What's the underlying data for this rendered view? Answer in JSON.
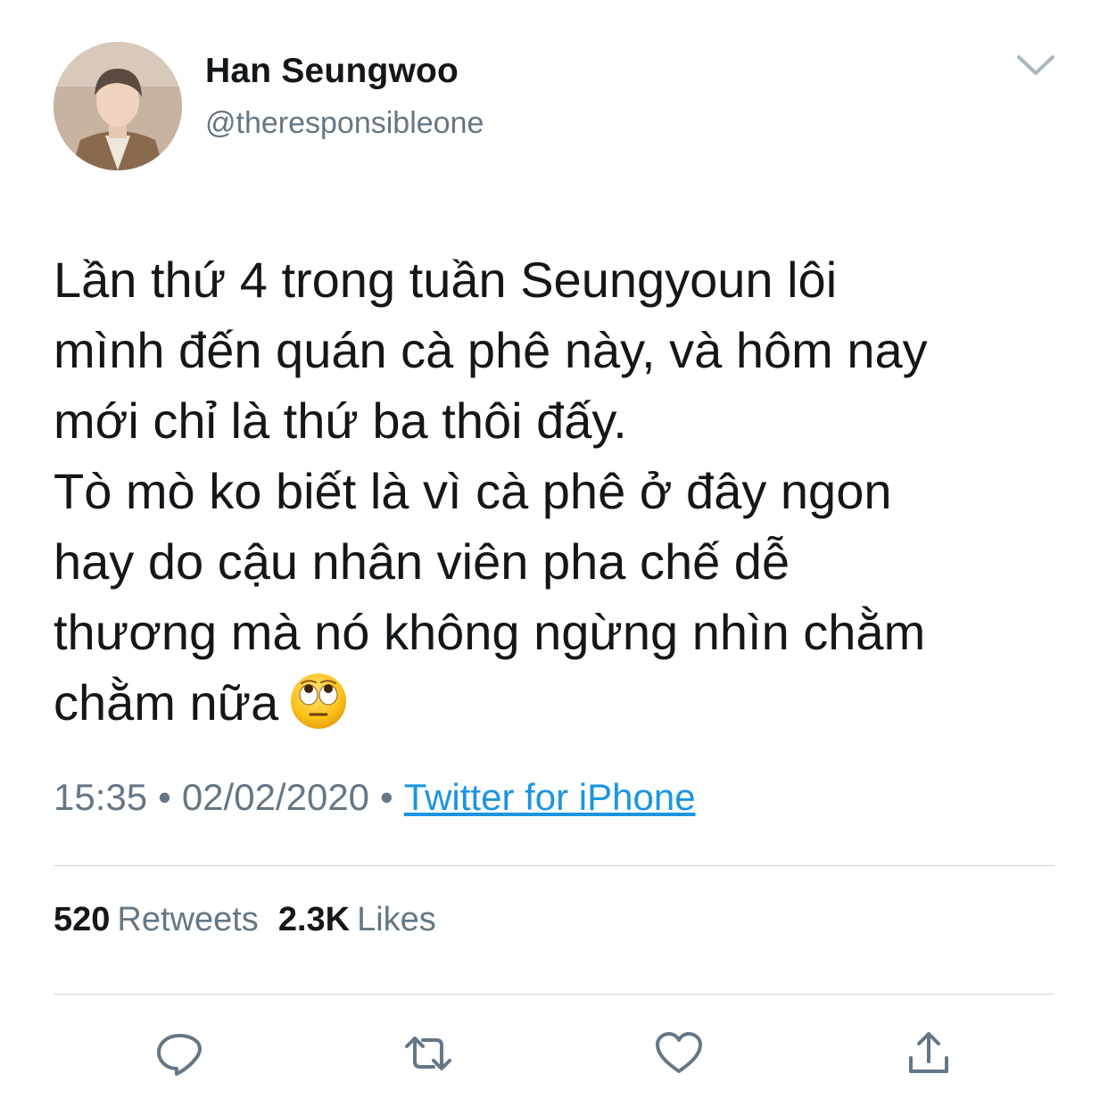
{
  "user": {
    "display_name": "Han Seungwoo",
    "handle": "@theresponsibleone"
  },
  "tweet": {
    "text_lines": [
      "Lần thứ 4 trong tuần Seungyoun lôi",
      "mình đến quán cà phê này, và hôm nay",
      "mới chỉ là thứ ba thôi đấy.",
      "Tò mò ko biết là vì cà phê ở đây ngon",
      "hay do cậu nhân viên pha chế dễ",
      "thương mà nó không ngừng nhìn chằm",
      "chằm nữa"
    ],
    "emoji": "face-with-rolling-eyes",
    "time": "15:35",
    "date": "02/02/2020",
    "separator": "•",
    "source": "Twitter for iPhone"
  },
  "stats": {
    "retweets_count": "520",
    "retweets_label": "Retweets",
    "likes_count": "2.3K",
    "likes_label": "Likes"
  },
  "icons": {
    "menu": "chevron-down-icon",
    "reply": "reply-icon",
    "retweet": "retweet-icon",
    "like": "heart-icon",
    "share": "share-icon"
  },
  "colors": {
    "text": "#14171a",
    "secondary": "#657786",
    "link": "#1b95e0",
    "icon": "#657786",
    "divider": "#ccd6dd"
  }
}
